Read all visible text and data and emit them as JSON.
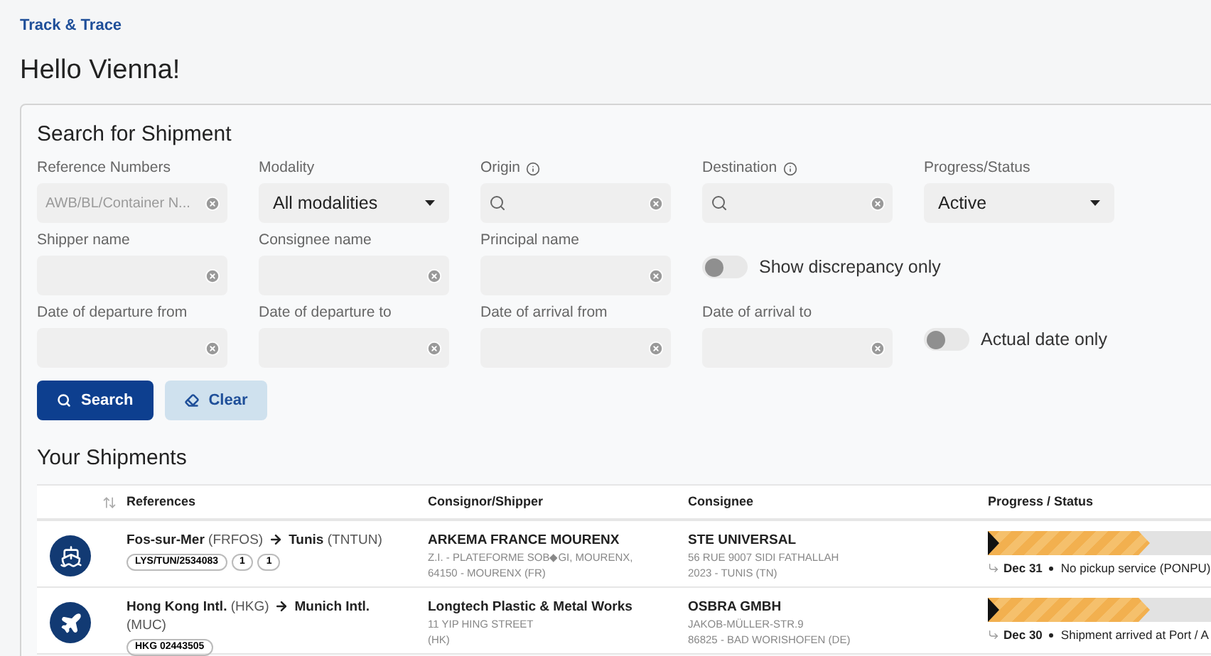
{
  "breadcrumb": "Track & Trace",
  "greeting": "Hello Vienna!",
  "search_panel": {
    "title": "Search for Shipment",
    "rows": [
      [
        {
          "kind": "text",
          "label": "Reference Numbers",
          "placeholder": "AWB/BL/Container N..."
        },
        {
          "kind": "select",
          "label": "Modality",
          "value": "All modalities"
        },
        {
          "kind": "search",
          "label": "Origin",
          "info": true
        },
        {
          "kind": "search",
          "label": "Destination",
          "info": true
        },
        {
          "kind": "select",
          "label": "Progress/Status",
          "value": "Active"
        }
      ],
      [
        {
          "kind": "text",
          "label": "Shipper name"
        },
        {
          "kind": "text",
          "label": "Consignee name"
        },
        {
          "kind": "text",
          "label": "Principal name"
        },
        {
          "kind": "toggle",
          "label": "Show discrepancy only",
          "on": false
        }
      ],
      [
        {
          "kind": "text",
          "label": "Date of departure from"
        },
        {
          "kind": "text",
          "label": "Date of departure to"
        },
        {
          "kind": "text",
          "label": "Date of arrival from"
        },
        {
          "kind": "text",
          "label": "Date of arrival to"
        },
        {
          "kind": "toggle",
          "label": "Actual date only",
          "on": false
        }
      ]
    ],
    "buttons": [
      {
        "kind": "primary",
        "label": "Search"
      },
      {
        "kind": "secondary",
        "label": "Clear"
      }
    ]
  },
  "shipments": {
    "title": "Your Shipments",
    "columns": [
      "References",
      "Consignor/Shipper",
      "Consignee",
      "Progress / Status"
    ],
    "rows": [
      {
        "kind": "ship",
        "origin": "Fos-sur-Mer",
        "origin_code": "(FRFOS)",
        "destination": "Tunis",
        "destination_code": "(TNTUN)",
        "tags": [
          "LYS/TUN/2534083",
          "1",
          "1"
        ],
        "shipper": {
          "name": "ARKEMA FRANCE MOURENX",
          "address": [
            "Z.I. - PLATEFORME SOB◆GI, MOURENX,",
            "64150 - MOURENX (FR)"
          ]
        },
        "consignee": {
          "name": "STE UNIVERSAL",
          "address": [
            "56 RUE 9007 SIDI FATHALLAH",
            "2023 - TUNIS (TN)"
          ]
        },
        "progress": {
          "level": 0.6,
          "date": "Dec 31",
          "status": "No pickup service (PONPU)"
        }
      },
      {
        "kind": "plane",
        "origin": "Hong Kong Intl.",
        "origin_code": "(HKG)",
        "destination": "Munich Intl.",
        "destination_code": "(MUC)",
        "tags": [
          "HKG 02443505"
        ],
        "shipper": {
          "name": "Longtech Plastic & Metal Works",
          "address": [
            "11 YIP HING STREET",
            "(HK)"
          ]
        },
        "consignee": {
          "name": "OSBRA GMBH",
          "address": [
            "JAKOB-MÜLLER-STR.9",
            "86825 - BAD WORISHOFEN (DE)"
          ]
        },
        "progress": {
          "level": 0.6,
          "date": "Dec 30",
          "status": "Shipment arrived at Port / A"
        }
      }
    ]
  }
}
